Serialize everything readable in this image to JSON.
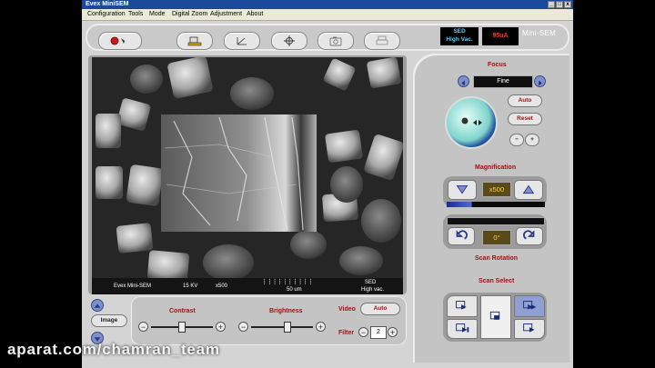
{
  "window": {
    "title": "Evex MiniSEM",
    "controls": [
      "_",
      "□",
      "x"
    ]
  },
  "menu": [
    "Configuration",
    "Tools",
    "Mode",
    "Digital Zoom",
    "Adjustment",
    "About"
  ],
  "toolbar": {
    "buttons": [
      "power-scan",
      "stage",
      "measure",
      "crosshair",
      "camera",
      "print"
    ]
  },
  "status": {
    "detector": "SED",
    "vacuum": "High Vac.",
    "current": "95uA",
    "brand": "Mini-SEM"
  },
  "image_info": {
    "label": "Evex Mini-SEM",
    "kv": "15 KV",
    "mag": "x500",
    "scale": "50 um",
    "detector": "SED",
    "vacuum": "High vac."
  },
  "bottom": {
    "image_btn": "Image",
    "contrast_label": "Contrast",
    "brightness_label": "Brightness",
    "video_label": "Video",
    "auto_label": "Auto",
    "filter_label": "Filter",
    "filter_value": "2",
    "minus": "−",
    "plus": "+"
  },
  "focus": {
    "title": "Focus",
    "mode": "Fine",
    "auto": "Auto",
    "reset": "Reset",
    "minus": "−",
    "plus": "+"
  },
  "magnification": {
    "title": "Magnification",
    "value": "x500"
  },
  "rotation": {
    "title": "Scan Rotation",
    "value": "0°"
  },
  "scan_select": {
    "title": "Scan Select"
  },
  "watermark": "aparat.com/chamran_team",
  "colors": {
    "accent_red": "#a01010",
    "title_blue": "#1b4a9c",
    "button_blue": "#7f8fc8"
  }
}
